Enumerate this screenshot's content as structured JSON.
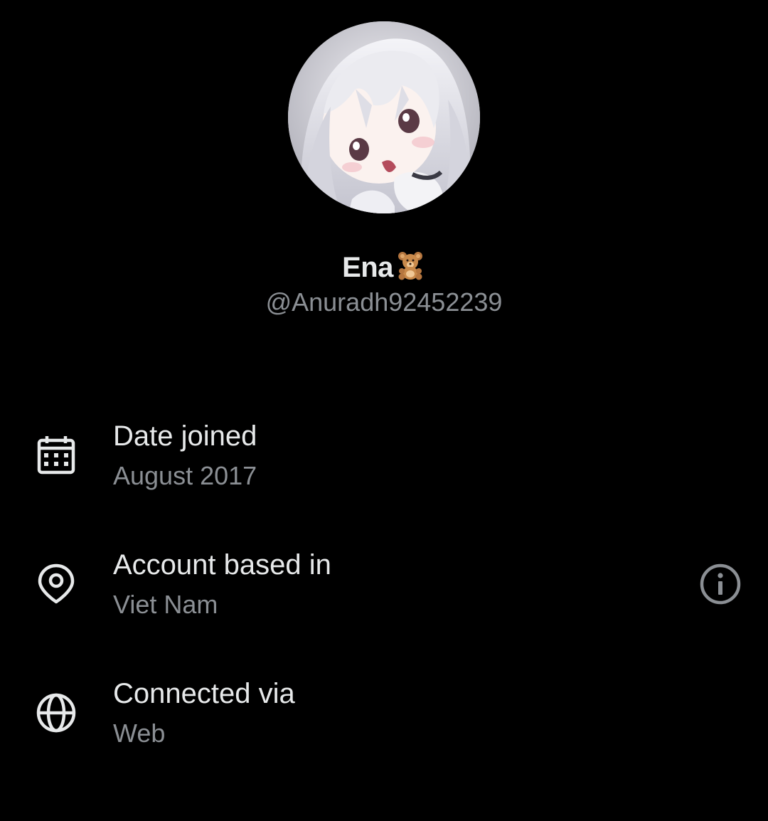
{
  "profile": {
    "display_name": "Ena",
    "name_emoji": "teddy-bear",
    "handle": "@Anuradh92452239"
  },
  "details": [
    {
      "icon": "calendar-icon",
      "title": "Date joined",
      "value": "August 2017"
    },
    {
      "icon": "location-pin-icon",
      "title": "Account based in",
      "value": "Viet Nam",
      "action_icon": "info-icon"
    },
    {
      "icon": "globe-icon",
      "title": "Connected via",
      "value": "Web"
    }
  ],
  "colors": {
    "background": "#000000",
    "primary_text": "#e7e9ea",
    "secondary_text": "#8b8f94",
    "icon": "#e7e9ea",
    "info_icon": "#8b8f94"
  }
}
